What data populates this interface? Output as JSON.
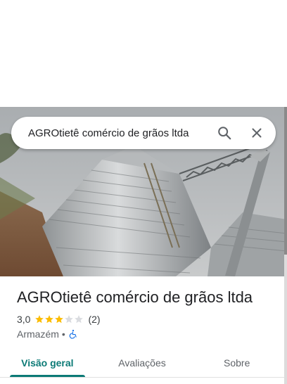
{
  "search": {
    "query": "AGROtietê comércio de grãos ltda",
    "search_icon": "search-icon",
    "close_icon": "close-icon"
  },
  "place": {
    "name": "AGROtietê comércio de grãos ltda",
    "rating": "3,0",
    "rating_value": 3,
    "rating_max": 5,
    "review_count": "(2)",
    "category": "Armazém",
    "separator": "•",
    "accessibility_icon": "wheelchair-icon"
  },
  "tabs": [
    {
      "label": "Visão geral",
      "active": true
    },
    {
      "label": "Avaliações",
      "active": false
    },
    {
      "label": "Sobre",
      "active": false
    }
  ],
  "colors": {
    "accent": "#0b7a76",
    "star_filled": "#fbbc04",
    "star_empty": "#dadce0",
    "accessibility": "#1a73e8"
  }
}
